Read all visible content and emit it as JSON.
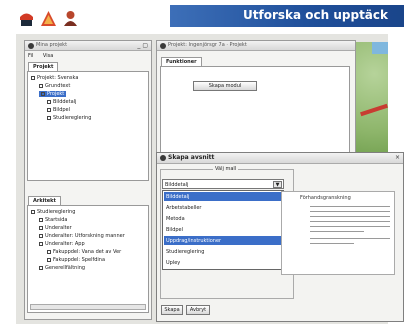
{
  "header": {
    "title": "Utforska och upptäck"
  },
  "left_window": {
    "title": "Mina projekt",
    "menu": [
      "Fil",
      "Visa"
    ],
    "project_tab": "Projekt",
    "project_tree": [
      {
        "label": "Projekt: Svenska",
        "indent": 0
      },
      {
        "label": "Grundtext",
        "indent": 1
      },
      {
        "label": "Projekt",
        "indent": 1,
        "selected": true
      },
      {
        "label": "Bilddetalj",
        "indent": 2
      },
      {
        "label": "Bildpel",
        "indent": 2
      },
      {
        "label": "Studiereglering",
        "indent": 2
      }
    ],
    "bottom_tab": "Arkitekt",
    "bottom_tree": [
      {
        "label": "Studiereglering",
        "indent": 0
      },
      {
        "label": "Startsida",
        "indent": 1
      },
      {
        "label": "Underalter",
        "indent": 1
      },
      {
        "label": "Underalter: Utforskning manner",
        "indent": 1
      },
      {
        "label": "Underalter: App",
        "indent": 1
      },
      {
        "label": "Fakuppdel: Vana det av Ver",
        "indent": 2
      },
      {
        "label": "Fakuppdel: Spelfdina",
        "indent": 2
      },
      {
        "label": "Generellfältning",
        "indent": 1
      }
    ]
  },
  "middle_window": {
    "title": "Projekt: Ingenjörsgr 7a · Projekt",
    "tab": "Funktioner",
    "button": "Skapa modul"
  },
  "dialog": {
    "title": "Skapa avsnitt",
    "group_legend": "Välj mall",
    "combo_value": "Bilddetalj",
    "combo_arrow": "▼",
    "options": [
      {
        "label": "Bilddetalj",
        "selected": true
      },
      {
        "label": "Arbetstabeller",
        "selected": false
      },
      {
        "label": "Metoda",
        "selected": false
      },
      {
        "label": "Bildpel",
        "selected": false
      },
      {
        "label": "Uppdrag/instruktioner",
        "selected": true
      },
      {
        "label": "Studiereglering",
        "selected": false
      },
      {
        "label": "Upley",
        "selected": false
      }
    ],
    "preview_heading": "Förhandsgranskning",
    "buttons": {
      "create": "Skapa",
      "cancel": "Avbryt"
    },
    "close_label": "×"
  }
}
